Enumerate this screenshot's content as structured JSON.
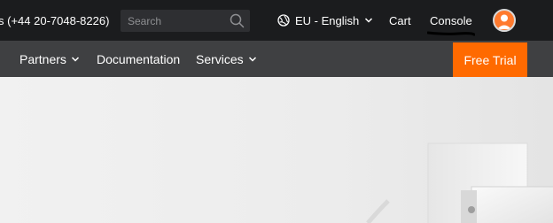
{
  "topbar": {
    "phone": "s (+44 20-7048-8226)",
    "search": {
      "placeholder": "Search"
    },
    "language": "EU - English",
    "cart": "Cart",
    "console": "Console"
  },
  "nav": {
    "items": [
      {
        "label": "Partners",
        "has_dropdown": true
      },
      {
        "label": "Documentation",
        "has_dropdown": false
      },
      {
        "label": "Services",
        "has_dropdown": true
      }
    ],
    "cta": "Free Trial"
  },
  "icons": {
    "search": "search-icon",
    "language": "globe-icon",
    "dropdown": "chevron-down-icon",
    "user": "user-avatar-icon"
  },
  "colors": {
    "topbar_bg": "#1b1c1e",
    "nav_bg": "#3f4042",
    "accent": "#ff6a00",
    "avatar": "#ff7a2e"
  }
}
